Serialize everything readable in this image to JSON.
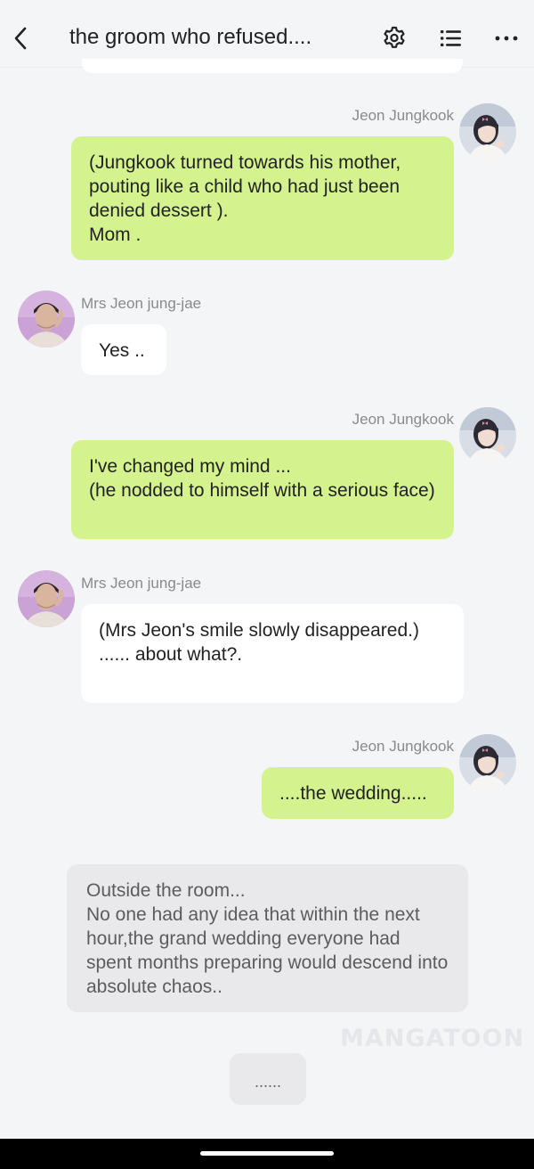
{
  "header": {
    "title": "the groom who refused....",
    "icons": [
      "chevron-left-icon",
      "gear-icon",
      "list-icon",
      "more-icon"
    ]
  },
  "messages": [
    {
      "sender": "Jeon Jungkook",
      "side": "right",
      "text": "(Jungkook turned towards his mother, pouting like a child who had just been denied dessert ).\nMom ."
    },
    {
      "sender": "Mrs Jeon jung-jae",
      "side": "left",
      "text": "Yes .."
    },
    {
      "sender": "Jeon Jungkook",
      "side": "right",
      "text": "I've changed my mind ...\n(he nodded to himself with a serious face)"
    },
    {
      "sender": "Mrs Jeon jung-jae",
      "side": "left",
      "text": "(Mrs Jeon's smile slowly disappeared.)\n...... about what?."
    },
    {
      "sender": "Jeon Jungkook",
      "side": "right",
      "text": "....the wedding....."
    }
  ],
  "narration": {
    "text": "Outside the room...\nNo one had any idea that within the next hour,the grand wedding everyone had spent months preparing would descend into absolute chaos.."
  },
  "watermark": "MANGATOON",
  "typing": "......",
  "colors": {
    "background": "#f4f5f7",
    "my_bubble": "#d4f38f",
    "their_bubble": "#ffffff",
    "narration_bubble": "#e9e9eb",
    "name_text": "#8a8a8a"
  }
}
